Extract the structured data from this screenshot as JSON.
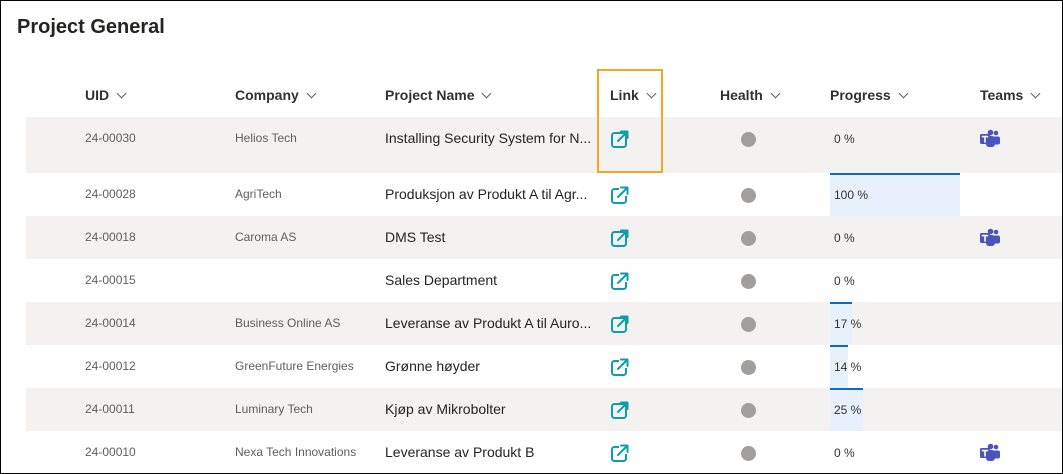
{
  "page": {
    "title": "Project General"
  },
  "columns": [
    {
      "id": "uid",
      "label": "UID"
    },
    {
      "id": "company",
      "label": "Company"
    },
    {
      "id": "project_name",
      "label": "Project Name"
    },
    {
      "id": "link",
      "label": "Link"
    },
    {
      "id": "health",
      "label": "Health"
    },
    {
      "id": "progress",
      "label": "Progress"
    },
    {
      "id": "teams",
      "label": "Teams"
    }
  ],
  "rows": [
    {
      "uid": "24-00030",
      "company": "Helios Tech",
      "project_name": "Installing Security System for N...",
      "progress": 0,
      "progress_label": "0 %",
      "teams": true
    },
    {
      "uid": "24-00028",
      "company": "AgriTech",
      "project_name": "Produksjon av Produkt A til Agr...",
      "progress": 100,
      "progress_label": "100 %",
      "teams": false
    },
    {
      "uid": "24-00018",
      "company": "Caroma AS",
      "project_name": "DMS Test",
      "progress": 0,
      "progress_label": "0 %",
      "teams": true
    },
    {
      "uid": "24-00015",
      "company": "",
      "project_name": "Sales Department",
      "progress": 0,
      "progress_label": "0 %",
      "teams": false
    },
    {
      "uid": "24-00014",
      "company": "Business Online AS",
      "project_name": "Leveranse av Produkt A til Auro...",
      "progress": 17,
      "progress_label": "17 %",
      "teams": false
    },
    {
      "uid": "24-00012",
      "company": "GreenFuture Energies",
      "project_name": "Grønne høyder",
      "progress": 14,
      "progress_label": "14 %",
      "teams": false
    },
    {
      "uid": "24-00011",
      "company": "Luminary Tech",
      "project_name": "Kjøp av Mikrobolter",
      "progress": 25,
      "progress_label": "25 %",
      "teams": false
    },
    {
      "uid": "24-00010",
      "company": "Nexa Tech Innovations",
      "project_name": "Leveranse av Produkt B",
      "progress": 0,
      "progress_label": "0 %",
      "teams": true
    }
  ],
  "icons": {
    "link": "open-external-link-icon",
    "health": "status-dot-icon",
    "teams": "microsoft-teams-icon"
  },
  "colors": {
    "link_icon": "#0f9ea8",
    "health_dot": "#a19f9d",
    "progress_bar": "#0f6cbd",
    "progress_bg": "#e8f1fb",
    "teams_icon": "#4b53bc",
    "highlight": "#f5a623",
    "row_alt": "#f3f2f1"
  }
}
